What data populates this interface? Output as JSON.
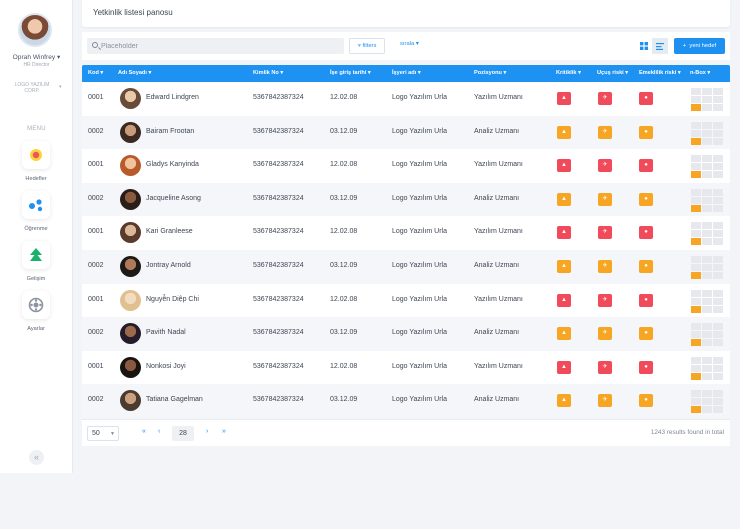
{
  "sidebar": {
    "user_name": "Oprah Winfrey",
    "user_role": "HR Director",
    "company": "LOGO YAZILIM CORP.",
    "menu_title": "MENU",
    "items": [
      {
        "label": "Hedefler",
        "icon": "target-icon"
      },
      {
        "label": "Öğrenme",
        "icon": "learning-icon"
      },
      {
        "label": "Gelişim",
        "icon": "growth-icon"
      },
      {
        "label": "Ayarlar",
        "icon": "settings-icon"
      }
    ],
    "collapse_icon": "double-chevron-left-icon"
  },
  "header": {
    "title": "Yetkinlik listesi panosu"
  },
  "toolbar": {
    "search_placeholder": "Placeholder",
    "filters_label": "filters",
    "sort_label": "sırala",
    "add_label": "yeni hedef"
  },
  "table": {
    "columns": [
      "Kod",
      "Adı Soyadı",
      "Kimlik No",
      "İşe giriş tarihi",
      "İşyeri adı",
      "Pozisyonu",
      "Kritiklik",
      "Uçuş riski",
      "Emeklilik riski",
      "n-Box"
    ],
    "rows": [
      {
        "kod": "0001",
        "name": "Edward Lindgren",
        "kimlik": "5367842387324",
        "tarih": "12.02.08",
        "isyeri": "Logo Yazılım Urla",
        "pozisyon": "Yazılım Uzmanı",
        "kritik": "red",
        "ucus": "red",
        "emeklilik": "red"
      },
      {
        "kod": "0002",
        "name": "Bairam Frootan",
        "kimlik": "5367842387324",
        "tarih": "03.12.09",
        "isyeri": "Logo Yazılım Urla",
        "pozisyon": "Analiz Uzmanı",
        "kritik": "orange",
        "ucus": "orange",
        "emeklilik": "orange"
      },
      {
        "kod": "0001",
        "name": "Gladys Kanyinda",
        "kimlik": "5367842387324",
        "tarih": "12.02.08",
        "isyeri": "Logo Yazılım Urla",
        "pozisyon": "Yazılım Uzmanı",
        "kritik": "red",
        "ucus": "red",
        "emeklilik": "red"
      },
      {
        "kod": "0002",
        "name": "Jacqueline Asong",
        "kimlik": "5367842387324",
        "tarih": "03.12.09",
        "isyeri": "Logo Yazılım Urla",
        "pozisyon": "Analiz Uzmanı",
        "kritik": "orange",
        "ucus": "orange",
        "emeklilik": "orange"
      },
      {
        "kod": "0001",
        "name": "Kari Granleese",
        "kimlik": "5367842387324",
        "tarih": "12.02.08",
        "isyeri": "Logo Yazılım Urla",
        "pozisyon": "Yazılım Uzmanı",
        "kritik": "red",
        "ucus": "red",
        "emeklilik": "red"
      },
      {
        "kod": "0002",
        "name": "Jontray Arnold",
        "kimlik": "5367842387324",
        "tarih": "03.12.09",
        "isyeri": "Logo Yazılım Urla",
        "pozisyon": "Analiz Uzmanı",
        "kritik": "orange",
        "ucus": "orange",
        "emeklilik": "orange"
      },
      {
        "kod": "0001",
        "name": "Nguyễn Diệp Chi",
        "kimlik": "5367842387324",
        "tarih": "12.02.08",
        "isyeri": "Logo Yazılım Urla",
        "pozisyon": "Yazılım Uzmanı",
        "kritik": "red",
        "ucus": "red",
        "emeklilik": "red"
      },
      {
        "kod": "0002",
        "name": "Pavith Nadal",
        "kimlik": "5367842387324",
        "tarih": "03.12.09",
        "isyeri": "Logo Yazılım Urla",
        "pozisyon": "Analiz Uzmanı",
        "kritik": "orange",
        "ucus": "orange",
        "emeklilik": "orange"
      },
      {
        "kod": "0001",
        "name": "Nonkosi Joyi",
        "kimlik": "5367842387324",
        "tarih": "12.02.08",
        "isyeri": "Logo Yazılım Urla",
        "pozisyon": "Yazılım Uzmanı",
        "kritik": "red",
        "ucus": "red",
        "emeklilik": "red"
      },
      {
        "kod": "0002",
        "name": "Tatiana Gagelman",
        "kimlik": "5367842387324",
        "tarih": "03.12.09",
        "isyeri": "Logo Yazılım Urla",
        "pozisyon": "Analiz Uzmanı",
        "kritik": "orange",
        "ucus": "orange",
        "emeklilik": "orange"
      }
    ]
  },
  "footer": {
    "page_size": "50",
    "current_page": "28",
    "results_text": "1243 results found in total"
  },
  "colors": {
    "accent": "#1e90f0",
    "red": "#f04a5b",
    "orange": "#f6a623",
    "nbox_active": "#f6a623"
  }
}
